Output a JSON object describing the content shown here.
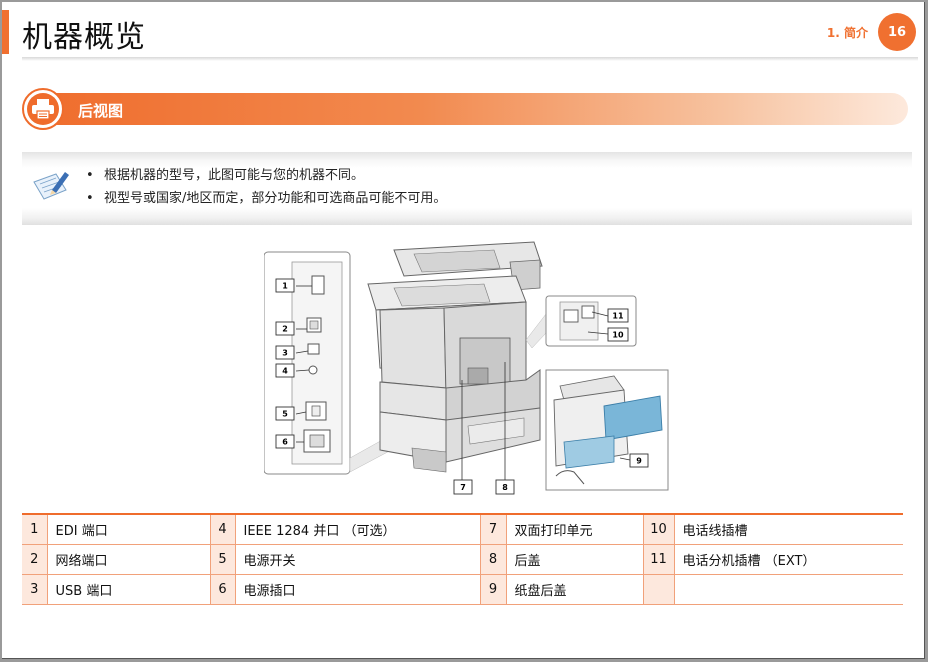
{
  "header": {
    "title": "机器概览",
    "breadcrumb": "1.  简介",
    "page_number": "16"
  },
  "section": {
    "title": "后视图",
    "icon": "printer-icon"
  },
  "note": {
    "icon": "note-pencil-icon",
    "items": [
      "根据机器的型号，此图可能与您的机器不同。",
      "视型号或国家/地区而定，部分功能和可选商品可能不可用。"
    ]
  },
  "diagram": {
    "callouts": [
      "1",
      "2",
      "3",
      "4",
      "5",
      "6",
      "7",
      "8",
      "9",
      "10",
      "11"
    ]
  },
  "legend": {
    "rows": [
      [
        {
          "num": "1",
          "label": "EDI 端口"
        },
        {
          "num": "4",
          "label": "IEEE 1284 并口 （可选）"
        },
        {
          "num": "7",
          "label": "双面打印单元"
        },
        {
          "num": "10",
          "label": "电话线插槽"
        }
      ],
      [
        {
          "num": "2",
          "label": "网络端口"
        },
        {
          "num": "5",
          "label": "电源开关"
        },
        {
          "num": "8",
          "label": "后盖"
        },
        {
          "num": "11",
          "label": "电话分机插槽 （EXT）"
        }
      ],
      [
        {
          "num": "3",
          "label": "USB 端口"
        },
        {
          "num": "6",
          "label": "电源插口"
        },
        {
          "num": "9",
          "label": "纸盘后盖"
        },
        {
          "num": "",
          "label": ""
        }
      ]
    ]
  },
  "colors": {
    "accent": "#f07030",
    "table_number_bg": "#fde8dd",
    "table_rule": "#f1a17a"
  }
}
